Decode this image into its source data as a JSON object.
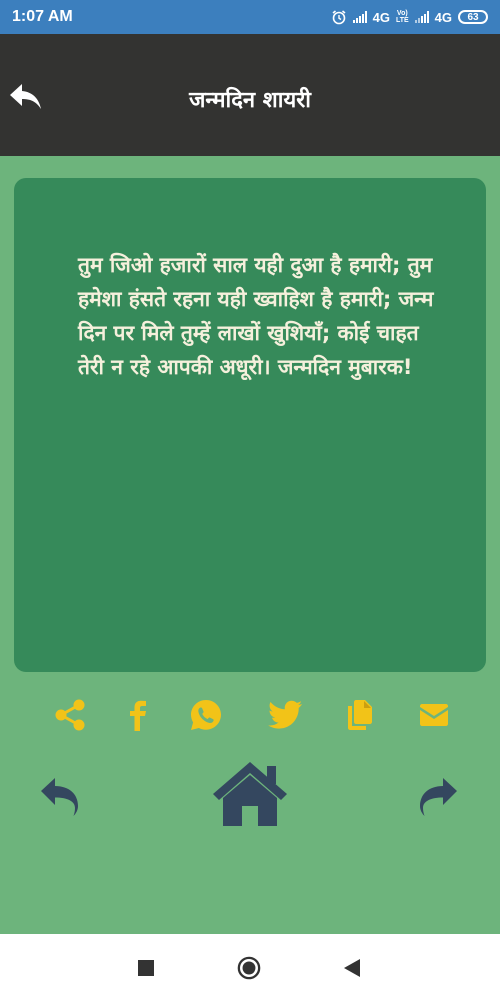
{
  "status_bar": {
    "time": "1:07 AM",
    "network_1": "4G",
    "volte_top": "Vo)",
    "volte_bottom": "LTE",
    "network_2": "4G",
    "battery": "63"
  },
  "app_bar": {
    "title": "जन्मदिन शायरी"
  },
  "card": {
    "text": "तुम जिओ हजारों साल यही दुआ है हमारी; तुम हमेशा हंसते रहना यही ख्वाहिश है हमारी; जन्म दिन पर मिले तुम्हें लाखों खुशियाँ; कोई चाहत तेरी न रहे आपकी अधूरी। जन्मदिन मुबारक!"
  },
  "colors": {
    "background": "#6db47c",
    "app_bar": "#333331",
    "card": "#368a5a",
    "card_text": "#f5f0dc",
    "share_icons": "#f2c318",
    "nav_icons": "#34475f",
    "status_bar": "#3c7fbe"
  },
  "share_icons": [
    "share-icon",
    "facebook-icon",
    "whatsapp-icon",
    "twitter-icon",
    "copy-icon",
    "email-icon"
  ],
  "nav_icons": [
    "undo-icon",
    "home-icon",
    "redo-icon"
  ],
  "system_nav": [
    "recents-icon",
    "home-circle-icon",
    "back-triangle-icon"
  ]
}
